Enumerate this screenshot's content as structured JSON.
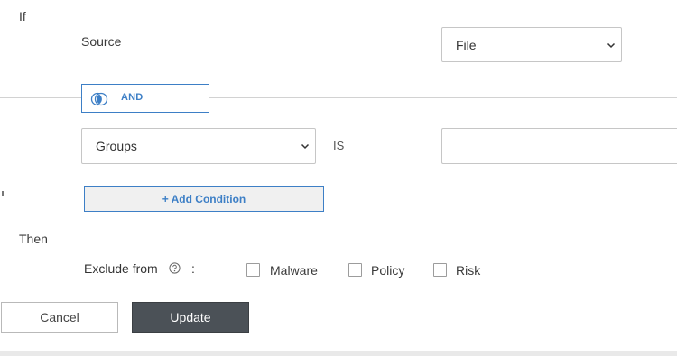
{
  "condition": {
    "if_label": "If",
    "source_label": "Source",
    "source_select_value": "File",
    "operator_label": "AND",
    "field_select_value": "Groups",
    "comparator_label": "IS",
    "value_input_value": "",
    "add_condition_label": "+ Add Condition"
  },
  "action": {
    "then_label": "Then",
    "exclude_label": "Exclude from",
    "colon": ":",
    "options": [
      {
        "label": "Malware",
        "checked": false
      },
      {
        "label": "Policy",
        "checked": false
      },
      {
        "label": "Risk",
        "checked": false
      }
    ]
  },
  "footer": {
    "cancel_label": "Cancel",
    "update_label": "Update"
  },
  "icons": {
    "and_operator": "venn-circles-icon",
    "help": "help-circle-icon",
    "dropdown": "chevron-down-icon"
  },
  "colors": {
    "accent": "#3d7fc6",
    "primary_button": "#4b5157",
    "border": "#c6c6c6"
  }
}
